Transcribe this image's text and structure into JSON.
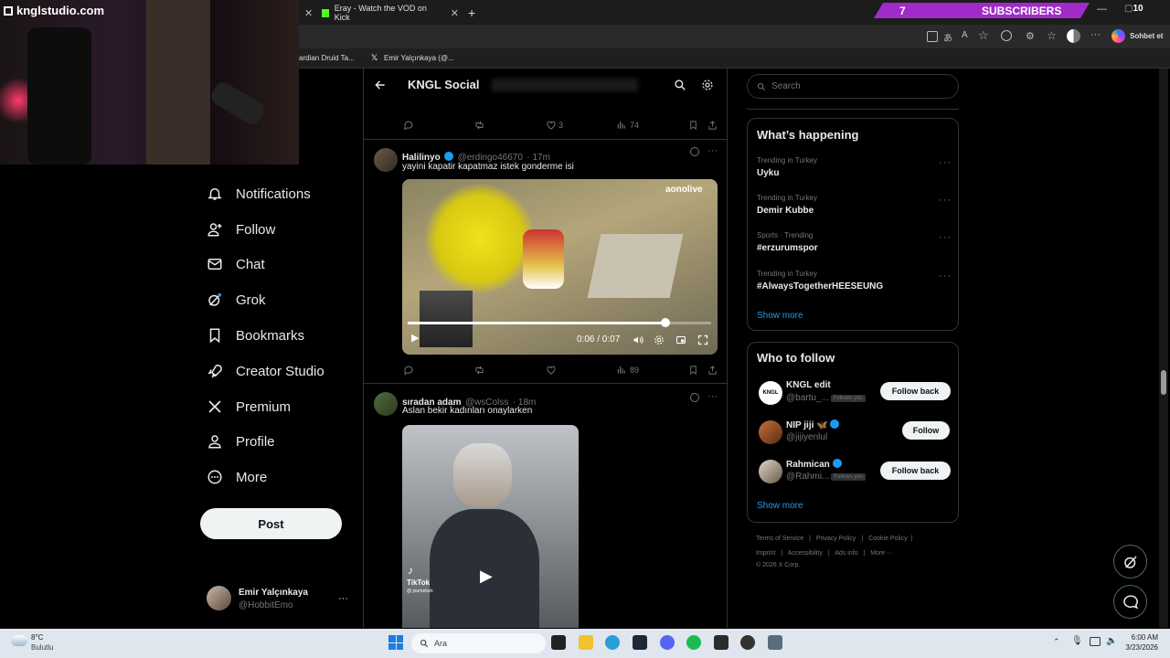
{
  "browser": {
    "tabs": [
      {
        "label": "Eray - Watch the VOD on Kick"
      }
    ],
    "subscribers": {
      "count": "7",
      "label": "SUBSCRIBERS"
    },
    "window_badge": "10",
    "copilot_label": "Sohbet et",
    "favorites": [
      {
        "label": "ardian Druid Ta..."
      },
      {
        "label": "Emir Yalçınkaya (@..."
      }
    ]
  },
  "webcam": {
    "watermark": "knglstudio.com"
  },
  "nav": {
    "items": [
      {
        "label": "Notifications",
        "icon": "bell-icon"
      },
      {
        "label": "Follow",
        "icon": "person-add-icon"
      },
      {
        "label": "Chat",
        "icon": "mail-icon"
      },
      {
        "label": "Grok",
        "icon": "grok-icon"
      },
      {
        "label": "Bookmarks",
        "icon": "bookmark-icon"
      },
      {
        "label": "Creator Studio",
        "icon": "rocket-icon"
      },
      {
        "label": "Premium",
        "icon": "x-logo-icon"
      },
      {
        "label": "Profile",
        "icon": "person-icon"
      },
      {
        "label": "More",
        "icon": "more-circle-icon"
      }
    ],
    "post_label": "Post",
    "account": {
      "name": "Emir Yalçınkaya",
      "handle": "@HobbitEmo",
      "more": "···"
    }
  },
  "header": {
    "title": "KNGL Social"
  },
  "feed": {
    "top_actions": {
      "likes": "3",
      "views": "74"
    },
    "tweets": [
      {
        "name": "Halilinyo",
        "handle": "@erdingo46670",
        "time": "· 17m",
        "text": "yayini kapatir kapatmaz istek gonderme isi",
        "video": {
          "time": "0:06 / 0:07",
          "progress": 0.85,
          "overlay_logo": "aonolive"
        },
        "views": "89"
      },
      {
        "name": "sıradan adam",
        "handle": "@wsColss",
        "time": "· 18m",
        "text": "Aslan bekir kadınları onaylarken",
        "video": {
          "tiktok_label": "TikTok",
          "tiktok_user": "@ journeturk"
        }
      }
    ]
  },
  "right": {
    "search_placeholder": "Search",
    "happening": {
      "title": "What’s happening",
      "trends": [
        {
          "context": "Trending in Turkey",
          "title": "Uyku"
        },
        {
          "context": "Trending in Turkey",
          "title": "Demir Kubbe"
        },
        {
          "context": "Sports · Trending",
          "title": "#erzurumspor"
        },
        {
          "context": "Trending in Turkey",
          "title": "#AlwaysTogetherHEESEUNG"
        }
      ],
      "show_more": "Show more"
    },
    "who_to_follow": {
      "title": "Who to follow",
      "users": [
        {
          "name": "KNGL edit",
          "handle": "@bartu_...",
          "follows_you": "Follows you",
          "button": "Follow back"
        },
        {
          "name": "NIP jiji 🦋",
          "handle": "@jijiyenlul",
          "follows_you": "",
          "button": "Follow"
        },
        {
          "name": "Rahmican",
          "handle": "@Rahmi...",
          "follows_you": "Follows you",
          "button": "Follow back"
        }
      ],
      "show_more": "Show more"
    },
    "footer": {
      "line1": [
        "Terms of Service",
        "Privacy Policy",
        "Cookie Policy"
      ],
      "line2": [
        "Imprint",
        "Accessibility",
        "Ads info",
        "More ···"
      ],
      "copyright": "© 2026 X Corp."
    }
  },
  "taskbar": {
    "weather_temp": "8°C",
    "weather_desc": "Bulutlu",
    "search_placeholder": "Ara",
    "time": "6:00 AM",
    "date": "3/23/2026"
  },
  "colors": {
    "accent": "#1d9bf0",
    "subscriber_bar": "#a12bc9",
    "background": "#000000"
  }
}
